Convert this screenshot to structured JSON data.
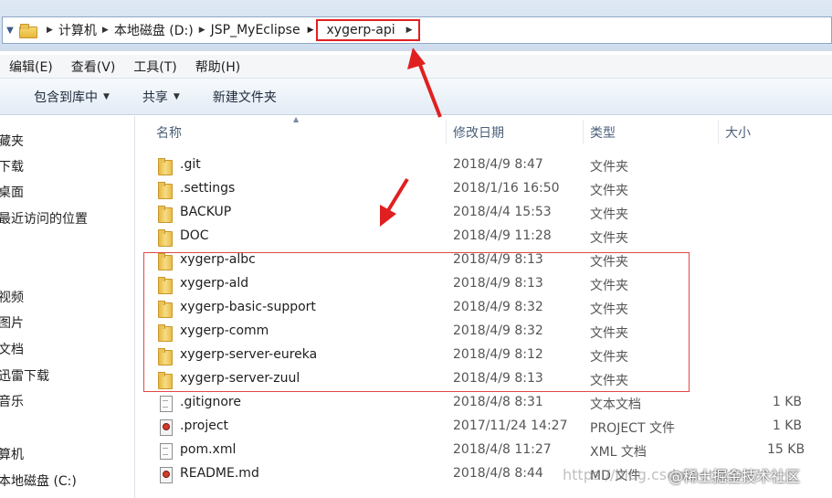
{
  "address": {
    "crumbs": [
      "计算机",
      "本地磁盘 (D:)",
      "JSP_MyEclipse",
      "xygerp-api"
    ]
  },
  "menu": [
    "编辑(E)",
    "查看(V)",
    "工具(T)",
    "帮助(H)"
  ],
  "toolbar": {
    "include_library": "包含到库中",
    "share": "共享",
    "new_folder": "新建文件夹"
  },
  "sidebar": [
    "藏夹",
    "下载",
    "桌面",
    "最近访问的位置",
    "视频",
    "图片",
    "文档",
    "迅雷下载",
    "音乐",
    "算机",
    "本地磁盘 (C:)"
  ],
  "columns": {
    "name": "名称",
    "modified": "修改日期",
    "type": "类型",
    "size": "大小"
  },
  "files": [
    {
      "name": ".git",
      "date": "2018/4/9 8:47",
      "type": "文件夹",
      "size": "",
      "icon": "folder-icon"
    },
    {
      "name": ".settings",
      "date": "2018/1/16 16:50",
      "type": "文件夹",
      "size": "",
      "icon": "folder-icon"
    },
    {
      "name": "BACKUP",
      "date": "2018/4/4 15:53",
      "type": "文件夹",
      "size": "",
      "icon": "folder-icon"
    },
    {
      "name": "DOC",
      "date": "2018/4/9 11:28",
      "type": "文件夹",
      "size": "",
      "icon": "folder-icon"
    },
    {
      "name": "xygerp-albc",
      "date": "2018/4/9 8:13",
      "type": "文件夹",
      "size": "",
      "icon": "folder-icon"
    },
    {
      "name": "xygerp-ald",
      "date": "2018/4/9 8:13",
      "type": "文件夹",
      "size": "",
      "icon": "folder-icon"
    },
    {
      "name": "xygerp-basic-support",
      "date": "2018/4/9 8:32",
      "type": "文件夹",
      "size": "",
      "icon": "folder-icon"
    },
    {
      "name": "xygerp-comm",
      "date": "2018/4/9 8:32",
      "type": "文件夹",
      "size": "",
      "icon": "folder-icon"
    },
    {
      "name": "xygerp-server-eureka",
      "date": "2018/4/9 8:12",
      "type": "文件夹",
      "size": "",
      "icon": "folder-icon"
    },
    {
      "name": "xygerp-server-zuul",
      "date": "2018/4/9 8:13",
      "type": "文件夹",
      "size": "",
      "icon": "folder-icon"
    },
    {
      "name": ".gitignore",
      "date": "2018/4/8 8:31",
      "type": "文本文档",
      "size": "1 KB",
      "icon": "text-file-icon"
    },
    {
      "name": ".project",
      "date": "2017/11/24 14:27",
      "type": "PROJECT 文件",
      "size": "1 KB",
      "icon": "project-file-icon"
    },
    {
      "name": "pom.xml",
      "date": "2018/4/8 11:27",
      "type": "XML 文档",
      "size": "15 KB",
      "icon": "xml-file-icon"
    },
    {
      "name": "README.md",
      "date": "2018/4/8 8:44",
      "type": "MD 文件",
      "size": "",
      "icon": "md-file-icon"
    }
  ],
  "watermark": {
    "url": "https://blog.csdn.net/XJ007",
    "site": "@稀土掘金技术社区"
  },
  "colors": {
    "annotation_red": "#e02020",
    "address_bg": "#dfe9f5"
  }
}
